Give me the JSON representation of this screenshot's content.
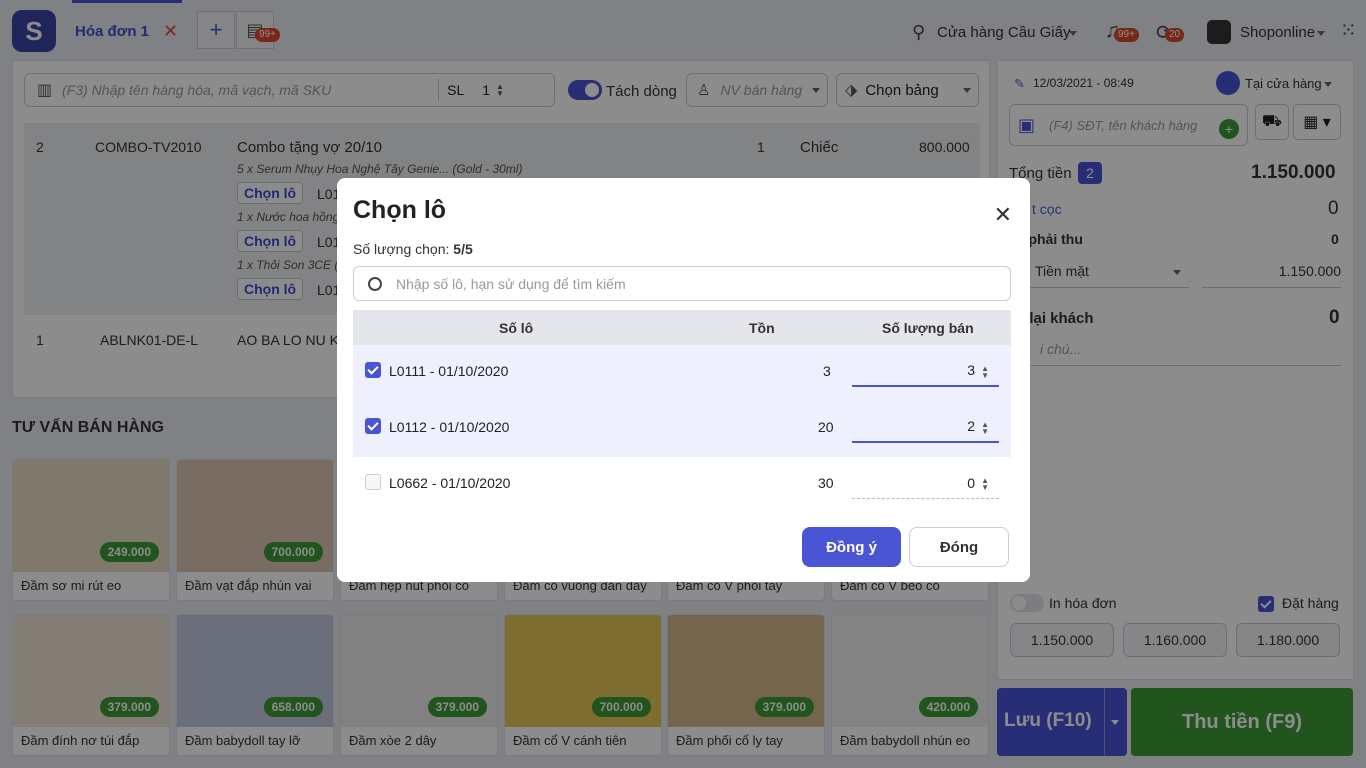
{
  "topbar": {
    "tab_label": "Hóa đơn 1",
    "badge_tabs": "99+",
    "store": "Cửa hàng Cầu Giấy",
    "notif_badge": "99+",
    "sync_badge": "20",
    "user": "Shoponline"
  },
  "search": {
    "placeholder": "(F3) Nhập tên hàng hóa, mã vạch, mã SKU",
    "sl_label": "SL",
    "sl_value": "1",
    "split_label": "Tách dòng",
    "seller_placeholder": "NV bán hàng",
    "price_table": "Chọn bảng"
  },
  "cart": {
    "row2": {
      "index": "2",
      "code": "COMBO-TV2010",
      "name": "Combo tặng vợ 20/10",
      "qty": "1",
      "unit": "Chiếc",
      "price": "800.000",
      "sub1": "5 x Serum Nhụy Hoa Nghệ Tây Genie... (Gold - 30ml)",
      "sub2": "1 x Nước hoa hồng",
      "sub3": "1 x Thỏi Son 3CE (H",
      "chon_lo": "Chọn lô",
      "lo": "L01"
    },
    "row1": {
      "index": "1",
      "code": "ABLNK01-DE-L",
      "name": "AO BA LO NU K"
    }
  },
  "advice": {
    "title": "TƯ VẤN BÁN HÀNG",
    "products": [
      {
        "name": "Đầm sơ mi rút eo",
        "price": "249.000",
        "color": "#e8dcc4"
      },
      {
        "name": "Đầm vạt đắp nhún vai",
        "price": "700.000",
        "color": "#dcc7b4"
      },
      {
        "name": "Đầm hẹp nút phối cổ",
        "price": "",
        "color": "#d8d4cc"
      },
      {
        "name": "Đầm cổ vuông dán dây",
        "price": "",
        "color": "#d6d0c6"
      },
      {
        "name": "Đầm cổ V phối tay",
        "price": "",
        "color": "#d0c8bc"
      },
      {
        "name": "Đầm cổ V bèo cổ",
        "price": "",
        "color": "#d4cec4"
      },
      {
        "name": "Đầm đính nơ túi đắp",
        "price": "379.000",
        "color": "#eee6d6"
      },
      {
        "name": "Đầm babydoll tay lỡ",
        "price": "658.000",
        "color": "#c2cbe0"
      },
      {
        "name": "Đầm xòe 2 dây",
        "price": "379.000",
        "color": "#ececec"
      },
      {
        "name": "Đầm cổ V cánh tiên",
        "price": "700.000",
        "color": "#e8c85a"
      },
      {
        "name": "Đầm phối cổ ly tay",
        "price": "379.000",
        "color": "#d6b88c"
      },
      {
        "name": "Đầm babydoll nhún eo",
        "price": "420.000",
        "color": "#eeeeee"
      }
    ]
  },
  "right": {
    "datetime": "12/03/2021 - 08:49",
    "channel": "Tại cửa hàng",
    "customer_placeholder": "(F4) SĐT, tên khách hàng",
    "total_label": "Tổng tiền",
    "total_count": "2",
    "total_value": "1.150.000",
    "deposit_label": "t cọc",
    "deposit_value": "0",
    "need_label": "n phải thu",
    "need_value": "0",
    "method": "Tiền mặt",
    "method_value": "1.150.000",
    "change_label": "n lại khách",
    "change_value": "0",
    "note_placeholder": "i chú...",
    "print_label": "In hóa đơn",
    "order_label": "Đặt hàng",
    "quick_amounts": [
      "1.150.000",
      "1.160.000",
      "1.180.000"
    ],
    "save_btn": "Lưu (F10)",
    "pay_btn": "Thu tiền (F9)"
  },
  "modal": {
    "title": "Chọn lô",
    "count_label": "Số lượng chọn:",
    "count_value": "5/5",
    "search_placeholder": "Nhập số lô, hạn sử dụng để tìm kiếm",
    "columns": [
      "Số lô",
      "Tồn",
      "Số lượng bán"
    ],
    "rows": [
      {
        "lot": "L0111 - 01/10/2020",
        "stock": "3",
        "qty": "3",
        "checked": true
      },
      {
        "lot": "L0112 - 01/10/2020",
        "stock": "20",
        "qty": "2",
        "checked": true
      },
      {
        "lot": "L0662 - 01/10/2020",
        "stock": "30",
        "qty": "0",
        "checked": false
      }
    ],
    "ok_label": "Đồng ý",
    "close_label": "Đóng"
  },
  "colors": {
    "primary": "#4a55d6",
    "success": "#3f9a36",
    "danger": "#e04848"
  }
}
